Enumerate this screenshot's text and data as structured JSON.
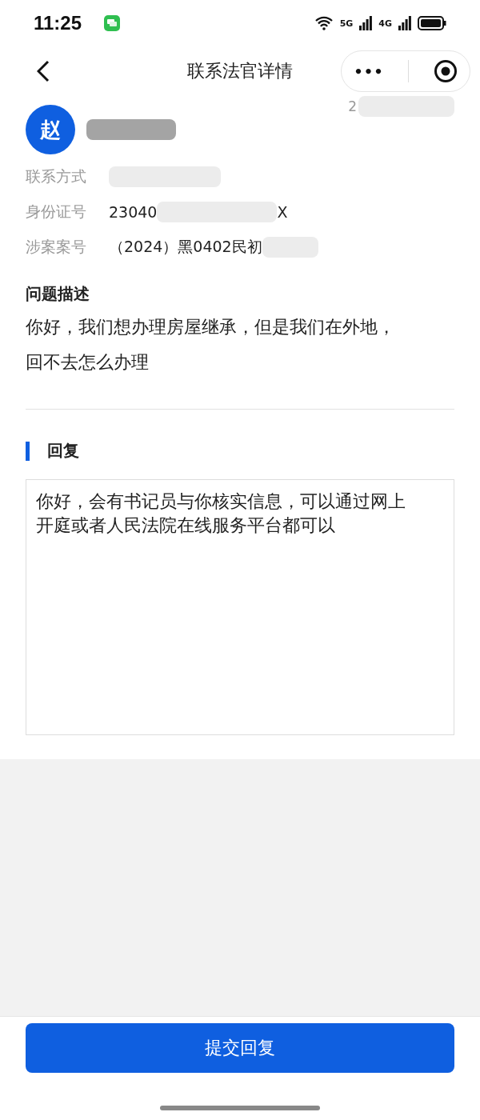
{
  "status_bar": {
    "time": "11:25",
    "network_labels": [
      "5G",
      "4G"
    ]
  },
  "nav": {
    "title": "联系法官详情",
    "more_icon": "•••"
  },
  "person": {
    "avatar": "赵",
    "date_prefix": "2"
  },
  "fields": [
    {
      "label": "联系方式"
    },
    {
      "label": "身份证号",
      "value": "23040",
      "suffix": "X"
    },
    {
      "label": "涉案案号",
      "value": "（2024）黑0402民初"
    }
  ],
  "question": {
    "title": "问题描述",
    "text": "你好，我们想办理房屋继承，但是我们在外地，回不去怎么办理"
  },
  "reply": {
    "title": "回复",
    "value": "你好，会有书记员与你核实信息，可以通过网上开庭或者人民法院在线服务平台都可以"
  },
  "submit_button": "提交回复"
}
